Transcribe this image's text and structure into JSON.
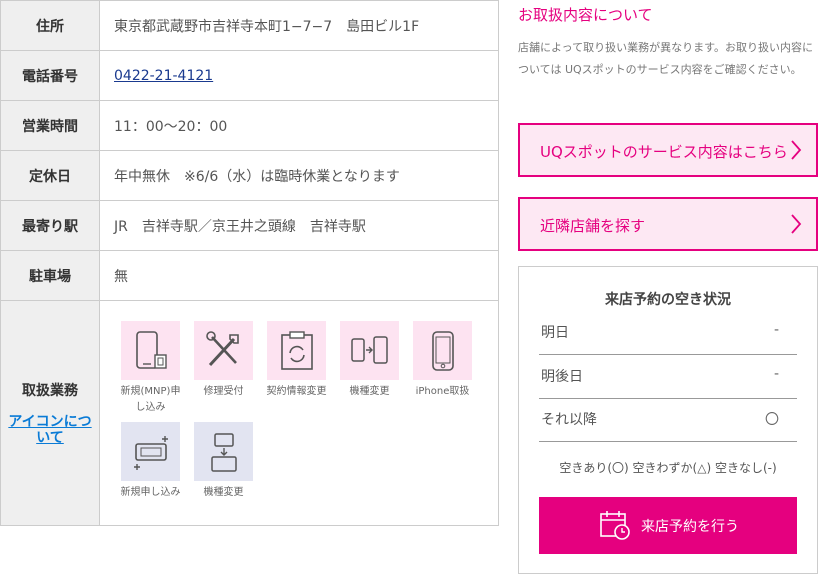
{
  "store_table": {
    "rows": [
      {
        "label": "住所",
        "value": "東京都武蔵野市吉祥寺本町1−7−7　島田ビル1F"
      },
      {
        "label": "電話番号",
        "value": "0422-21-4121"
      },
      {
        "label": "営業時間",
        "value": "11：00〜20：00"
      },
      {
        "label": "定休日",
        "value": "年中無休　※6/6（水）は臨時休業となります"
      },
      {
        "label": "最寄り駅",
        "value": "JR　吉祥寺駅／京王井之頭線　吉祥寺駅"
      },
      {
        "label": "駐車場",
        "value": "無"
      }
    ],
    "services": {
      "label": "取扱業務",
      "icon_link": "アイコンについて",
      "icons": [
        {
          "name": "phone-sim-icon",
          "caption": "新規(MNP)申し込み",
          "color": "pink"
        },
        {
          "name": "repair-tools-icon",
          "caption": "修理受付",
          "color": "pink"
        },
        {
          "name": "clipboard-refresh-icon",
          "caption": "契約情報変更",
          "color": "pink"
        },
        {
          "name": "phone-swap-icon",
          "caption": "機種変更",
          "color": "pink"
        },
        {
          "name": "iphone-icon",
          "caption": "iPhone取扱",
          "color": "pink"
        },
        {
          "name": "router-new-icon",
          "caption": "新規申し込み",
          "color": "blue"
        },
        {
          "name": "router-swap-icon",
          "caption": "機種変更",
          "color": "blue"
        }
      ]
    }
  },
  "about": {
    "heading": "お取扱内容について",
    "text": "店舗によって取り扱い業務が異なります。お取り扱い内容については UQスポットのサービス内容をご確認ください。"
  },
  "buttons": {
    "service": "UQスポットのサービス内容はこちら",
    "nearby": "近隣店舗を探す"
  },
  "availability": {
    "title": "来店予約の空き状況",
    "rows": [
      {
        "day": "明日",
        "status": "-"
      },
      {
        "day": "明後日",
        "status": "-"
      },
      {
        "day": "それ以降",
        "status": "〇"
      }
    ],
    "legend": "空きあり(〇) 空きわずか(△) 空きなし(-)",
    "reserve_button": "来店予約を行う"
  },
  "colors": {
    "brand": "#e5007f",
    "brand_light": "#fde8f3",
    "icon_pink": "#fde3f1",
    "icon_blue": "#e2e4f1"
  }
}
